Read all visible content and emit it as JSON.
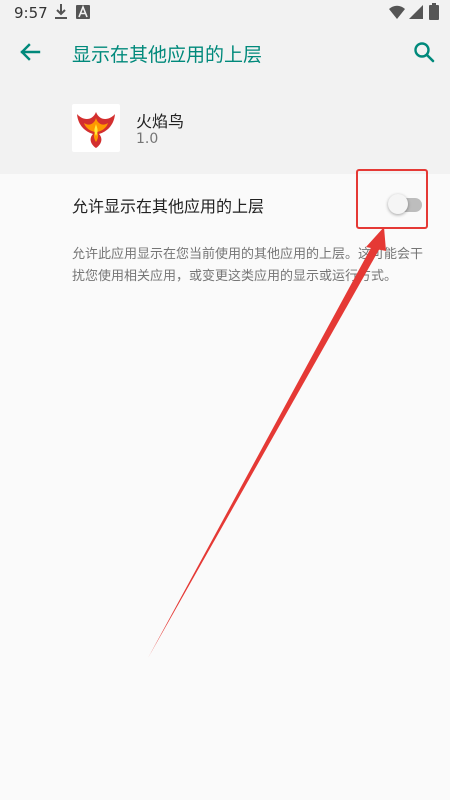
{
  "status_bar": {
    "time": "9:57",
    "left_icons": [
      "download-icon",
      "a-notification-icon"
    ],
    "right_icons": [
      "wifi-icon",
      "signal-icon",
      "battery-icon"
    ]
  },
  "app_bar": {
    "title": "显示在其他应用的上层",
    "back_icon": "arrow-back-icon",
    "search_icon": "search-icon"
  },
  "app_info": {
    "name": "火焰鸟",
    "version": "1.0",
    "icon": "phoenix-icon"
  },
  "setting": {
    "label": "允许显示在其他应用的上层",
    "enabled": false
  },
  "description": "允许此应用显示在您当前使用的其他应用的上层。这可能会干扰您使用相关应用，或变更这类应用的显示或运行方式。",
  "colors": {
    "accent": "#00897b",
    "annotation": "#e53935",
    "background": "#fafafa",
    "header_background": "#f2f2f2"
  }
}
